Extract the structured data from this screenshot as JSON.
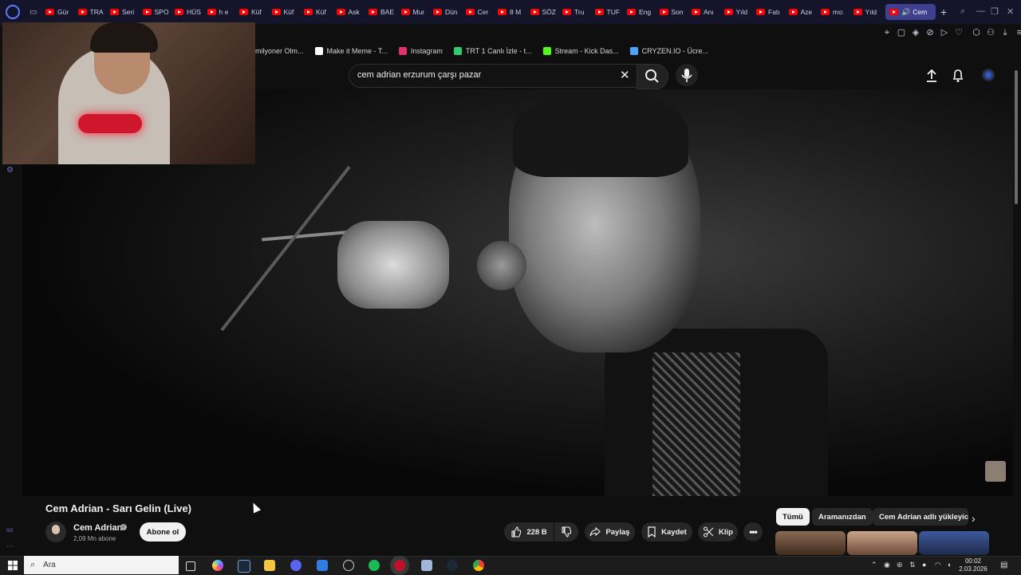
{
  "browser": {
    "tabs": [
      "Gür",
      "TRA",
      "Seri",
      "SPO",
      "HÜS",
      "h e",
      "Küf",
      "Küf",
      "Küf",
      "Ask",
      "BAE",
      "Mur",
      "Dün",
      "Cer",
      "8 M",
      "SÖZ",
      "Tru",
      "TUF",
      "Eng",
      "Son",
      "Anı",
      "Yıld",
      "Fatı",
      "Aze",
      "mo:",
      "Yıld"
    ],
    "active_tab": "Cem",
    "new_tab_symbol": "+",
    "accent_color": "#3e3f8e"
  },
  "bookmarks": [
    {
      "label": "milyoner Olm...",
      "icon": "none",
      "color": "#000000"
    },
    {
      "label": "Make it Meme - T...",
      "icon": "meme-icon",
      "color": "#ffffff"
    },
    {
      "label": "Instagram",
      "icon": "instagram-icon",
      "color": "#e1306c"
    },
    {
      "label": "TRT 1 Canlı İzle - t...",
      "icon": "trt-icon",
      "color": "#2ecc71"
    },
    {
      "label": "Stream - Kick Das...",
      "icon": "kick-icon",
      "color": "#53fc18"
    },
    {
      "label": "CRYZEN.IO - Ücre...",
      "icon": "cryzen-icon",
      "color": "#4ea3ff"
    }
  ],
  "youtube": {
    "search_query": "cem adrian erzurum çarşı pazar",
    "video_title": "Cem Adrian - Sarı Gelin (Live)",
    "channel_name": "Cem Adrian",
    "subscriber_count": "2,09 Mn abone",
    "subscribe_label": "Abone ol",
    "like_count": "228 B",
    "share_label": "Paylaş",
    "save_label": "Kaydet",
    "clip_label": "Klip",
    "chips": [
      "Tümü",
      "Aramanızdan",
      "Cem Adrian adlı yükleyic"
    ]
  },
  "taskbar": {
    "search_placeholder": "Ara",
    "time": "00:02",
    "date": "2.03.2026"
  }
}
